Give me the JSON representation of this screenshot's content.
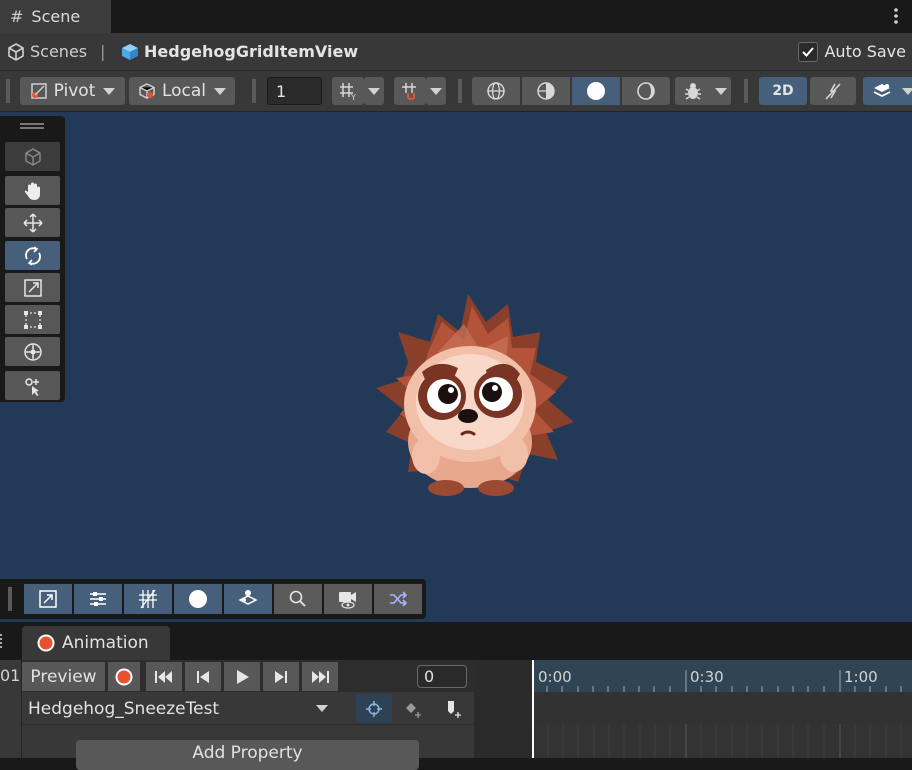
{
  "scene_tab": {
    "hash": "#",
    "label": "Scene"
  },
  "breadcrumb": {
    "root": "Scenes",
    "separator": "|",
    "object": "HedgehogGridItemView"
  },
  "autosave": {
    "label": "Auto Save",
    "checked": true
  },
  "toolbar": {
    "pivot_label": "Pivot",
    "space_label": "Local",
    "snap_value": "1",
    "mode_2d_label": "2D"
  },
  "animation": {
    "tab_label": "Animation",
    "left_stub": "01",
    "preview_label": "Preview",
    "frame_value": "0",
    "clip_name": "Hedgehog_SneezeTest",
    "add_property_label": "Add Property",
    "timeline_ticks": [
      "0:00",
      "0:30",
      "1:00"
    ]
  },
  "colors": {
    "scene_background": "#223a57",
    "active_button": "#46607c",
    "record": "#e8502f",
    "panel": "#383838"
  }
}
